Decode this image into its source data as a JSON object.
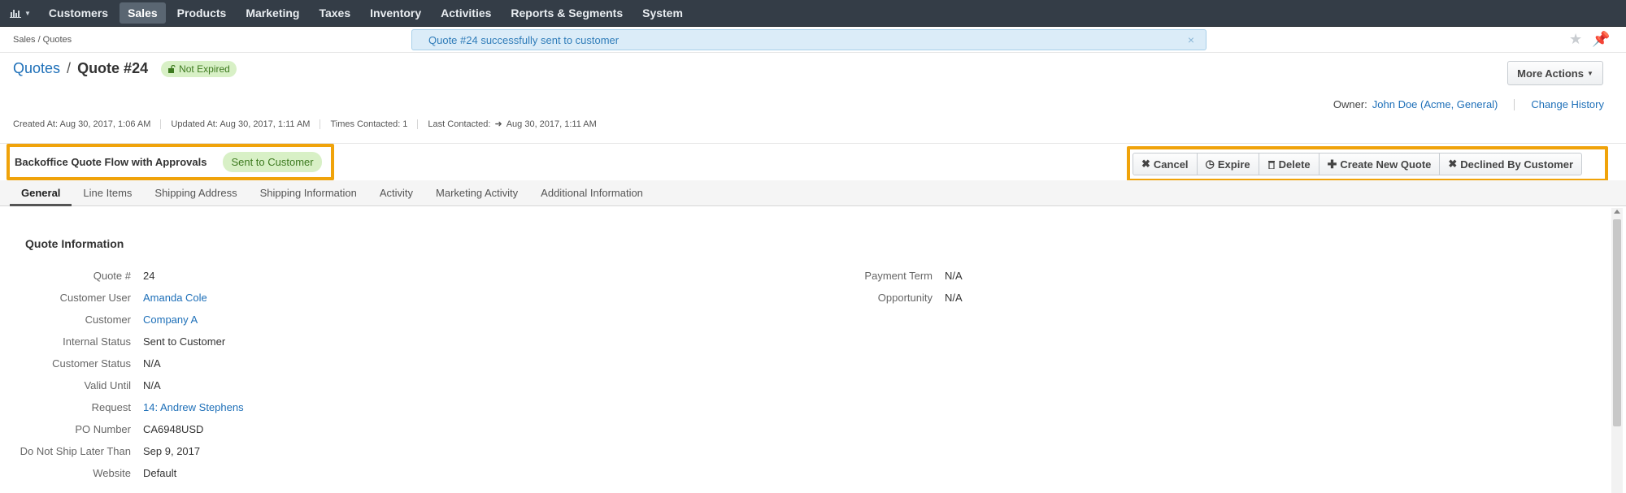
{
  "nav": {
    "chart_icon": "bar-chart-icon",
    "items": [
      "Customers",
      "Sales",
      "Products",
      "Marketing",
      "Taxes",
      "Inventory",
      "Activities",
      "Reports & Segments",
      "System"
    ],
    "active": "Sales"
  },
  "breadcrumb": "Sales / Quotes",
  "flash": {
    "message": "Quote #24 successfully sent to customer",
    "close": "×"
  },
  "header": {
    "section_link": "Quotes",
    "separator": "/",
    "title": "Quote #24",
    "status_badge": "Not Expired",
    "more_actions": "More Actions"
  },
  "owner": {
    "label": "Owner:",
    "name": "John Doe (Acme, General)",
    "change_history": "Change History"
  },
  "meta": {
    "created": "Created At: Aug 30, 2017, 1:06 AM",
    "updated": "Updated At: Aug 30, 2017, 1:11 AM",
    "times_contacted": "Times Contacted: 1",
    "last_contacted_label": "Last Contacted:",
    "last_contacted_value": "Aug 30, 2017, 1:11 AM"
  },
  "workflow": {
    "name": "Backoffice Quote Flow with Approvals",
    "step": "Sent to Customer",
    "actions": [
      {
        "label": "Cancel",
        "icon": "close-icon"
      },
      {
        "label": "Expire",
        "icon": "clock-icon"
      },
      {
        "label": "Delete",
        "icon": "trash-icon"
      },
      {
        "label": "Create New Quote",
        "icon": "plus-icon"
      },
      {
        "label": "Declined By Customer",
        "icon": "close-icon"
      }
    ]
  },
  "tabs": [
    "General",
    "Line Items",
    "Shipping Address",
    "Shipping Information",
    "Activity",
    "Marketing Activity",
    "Additional Information"
  ],
  "active_tab": "General",
  "quote_info": {
    "title": "Quote Information",
    "left": [
      {
        "label": "Quote #",
        "value": "24",
        "link": false
      },
      {
        "label": "Customer User",
        "value": "Amanda Cole",
        "link": true
      },
      {
        "label": "Customer",
        "value": "Company A",
        "link": true
      },
      {
        "label": "Internal Status",
        "value": "Sent to Customer",
        "link": false
      },
      {
        "label": "Customer Status",
        "value": "N/A",
        "link": false
      },
      {
        "label": "Valid Until",
        "value": "N/A",
        "link": false
      },
      {
        "label": "Request",
        "value": "14: Andrew Stephens",
        "link": true
      },
      {
        "label": "PO Number",
        "value": "CA6948USD",
        "link": false
      },
      {
        "label": "Do Not Ship Later Than",
        "value": "Sep 9, 2017",
        "link": false
      },
      {
        "label": "Website",
        "value": "Default",
        "link": false
      }
    ],
    "right": [
      {
        "label": "Payment Term",
        "value": "N/A",
        "link": false
      },
      {
        "label": "Opportunity",
        "value": "N/A",
        "link": false
      }
    ]
  },
  "colors": {
    "nav_bg": "#343d47",
    "link": "#1d6fb8",
    "highlight": "#f0a30a",
    "badge_bg": "#d8f0c6",
    "flash_bg": "#dbecf8"
  }
}
